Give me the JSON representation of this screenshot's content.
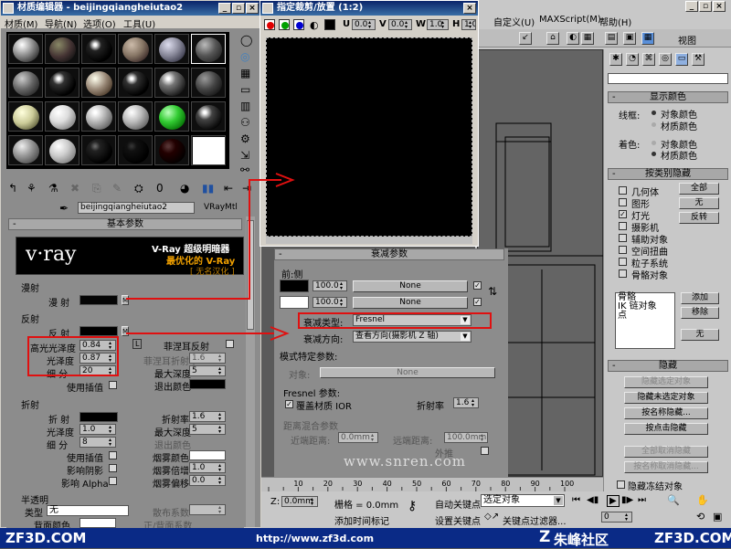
{
  "mat_editor": {
    "title": "材质编辑器 - beijingqiangheiutao2",
    "menu": [
      "材质(M)",
      "导航(N)",
      "选项(O)",
      "工具(U)"
    ],
    "material_name": "beijingqiangheiutao2",
    "material_type": "VRayMtl",
    "rollout_basic": "基本参数",
    "vray_banner_title": "V-Ray 超级明暗器",
    "vray_banner_sub": "最优化的 V-Ray",
    "vray_banner_tag": "[ 无名汉化 ]",
    "vray_logo": "v·ray",
    "diffuse_section": "漫射",
    "diffuse_label": "漫 射",
    "reflection_section": "反射",
    "reflect_label": "反 射",
    "hilight_gloss_label": "高光光泽度",
    "hilight_gloss": "0.84",
    "gloss_label": "光泽度",
    "gloss": "0.87",
    "subdivs_label": "细 分",
    "subdivs": "20",
    "use_interp": "使用插值",
    "fresnel_label": "菲涅耳反射",
    "fresnel_ior_label": "菲涅耳折射率",
    "fresnel_ior": "1.6",
    "max_depth_label": "最大深度",
    "max_depth": "5",
    "exit_color_label": "退出颜色",
    "refraction_section": "折射",
    "refract_label": "折 射",
    "ior_label": "折射率",
    "ior": "1.6",
    "r_gloss_label": "光泽度",
    "r_gloss": "1.0",
    "r_maxdepth_label": "最大深度",
    "r_maxdepth": "5",
    "r_subdivs_label": "细 分",
    "r_subdivs": "8",
    "r_exit_color_label": "退出颜色",
    "r_use_interp": "使用插值",
    "fog_color": "烟雾颜色",
    "affect_shadows": "影响阴影",
    "fog_mult": "烟雾倍增",
    "fog_mult_val": "1.0",
    "affect_alpha": "影响 Alpha",
    "fog_bias": "烟雾偏移",
    "fog_bias_val": "0.0",
    "translucency_section": "半透明",
    "type_label": "类型",
    "type_value": "无",
    "back_color_label": "背面颜色",
    "scatter_coeff_label": "散布系数",
    "fwd_back_label": "正/背面系数"
  },
  "crop_window": {
    "title": "指定裁剪/放置 (1:2)",
    "u_label": "U",
    "u_val": "0.0",
    "v_label": "V",
    "v_val": "0.0",
    "w_label": "W",
    "w_val": "1.0",
    "h_label": "H",
    "h_val": "1.0"
  },
  "falloff": {
    "title": "衰减参数",
    "front_side": "前:侧",
    "val1": "100.0",
    "val2": "100.0",
    "none1": "None",
    "none2": "None",
    "falloff_type_label": "衰减类型:",
    "falloff_type": "Fresnel",
    "falloff_dir_label": "衰减方向:",
    "falloff_dir": "查看方向(摄影机 Z 轴)",
    "mode_params": "模式特定参数:",
    "object_label": "对象:",
    "object_val": "None",
    "fresnel_params": "Fresnel 参数:",
    "override_ior": "覆盖材质 IOR",
    "ior_label": "折射率",
    "ior_val": "1.6",
    "distance_blend": "距离混合参数",
    "near_label": "近端距离:",
    "near_val": "0.0mm",
    "far_label": "远端距离:",
    "far_val": "100.0mm",
    "extrapolate": "外推"
  },
  "main_menu": {
    "items": [
      "自定义(U)",
      "MAXScript(M)",
      "帮助(H)"
    ]
  },
  "toolbar": {
    "view_label": "视图"
  },
  "cmd_panel": {
    "display_color_title": "显示颜色",
    "wireframe_label": "线框:",
    "object_color": "对象颜色",
    "material_color": "材质颜色",
    "shaded_label": "着色:",
    "object_color2": "对象颜色",
    "material_color2": "材质颜色",
    "hide_by_cat_title": "按类别隐藏",
    "categories": [
      "几何体",
      "图形",
      "灯光",
      "摄影机",
      "辅助对象",
      "空间扭曲",
      "粒子系统",
      "骨骼对象"
    ],
    "all_btn": "全部",
    "none_btn": "无",
    "invert_btn": "反转",
    "list_items": [
      "骨骼",
      "IK 链对象",
      "点"
    ],
    "add_btn": "添加",
    "remove_btn": "移除",
    "none_btn2": "无",
    "hide_title": "隐藏",
    "hide_selected": "隐藏选定对象",
    "hide_unselected": "隐藏未选定对象",
    "hide_by_name": "按名称隐藏...",
    "hide_by_hit": "按点击隐藏",
    "unhide_all": "全部取消隐藏",
    "unhide_by_name": "按名称取消隐藏...",
    "hide_frozen": "隐藏冻结对象"
  },
  "timeline": {
    "ticks": [
      "10",
      "20",
      "30",
      "40",
      "50",
      "60",
      "70",
      "80",
      "90",
      "100"
    ]
  },
  "statusbar": {
    "z_label": "Z:",
    "z_val": "0.0mm",
    "grid_label": "栅格 = 0.0mm",
    "auto_key": "自动关键点",
    "selected_obj": "选定对象",
    "set_key": "设置关键点",
    "key_filter": "关键点过滤器...",
    "add_time_tag": "添加时间标记",
    "frame": "0"
  },
  "watermark": {
    "center_url": "www.snren.com",
    "left_site": "ZF3D.COM",
    "bottom_url": "http://www.zf3d.com",
    "community": "朱峰社区",
    "right_site": "ZF3D.COM"
  },
  "colors": {
    "accent_red": "#e01010",
    "title_blue": "#0a246a"
  }
}
